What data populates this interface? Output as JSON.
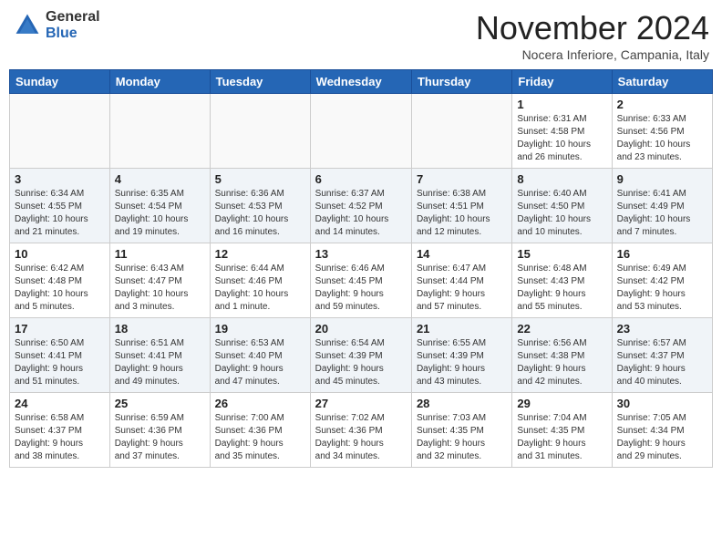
{
  "header": {
    "logo_general": "General",
    "logo_blue": "Blue",
    "month_title": "November 2024",
    "location": "Nocera Inferiore, Campania, Italy"
  },
  "days_of_week": [
    "Sunday",
    "Monday",
    "Tuesday",
    "Wednesday",
    "Thursday",
    "Friday",
    "Saturday"
  ],
  "weeks": [
    [
      {
        "day": "",
        "info": ""
      },
      {
        "day": "",
        "info": ""
      },
      {
        "day": "",
        "info": ""
      },
      {
        "day": "",
        "info": ""
      },
      {
        "day": "",
        "info": ""
      },
      {
        "day": "1",
        "info": "Sunrise: 6:31 AM\nSunset: 4:58 PM\nDaylight: 10 hours\nand 26 minutes."
      },
      {
        "day": "2",
        "info": "Sunrise: 6:33 AM\nSunset: 4:56 PM\nDaylight: 10 hours\nand 23 minutes."
      }
    ],
    [
      {
        "day": "3",
        "info": "Sunrise: 6:34 AM\nSunset: 4:55 PM\nDaylight: 10 hours\nand 21 minutes."
      },
      {
        "day": "4",
        "info": "Sunrise: 6:35 AM\nSunset: 4:54 PM\nDaylight: 10 hours\nand 19 minutes."
      },
      {
        "day": "5",
        "info": "Sunrise: 6:36 AM\nSunset: 4:53 PM\nDaylight: 10 hours\nand 16 minutes."
      },
      {
        "day": "6",
        "info": "Sunrise: 6:37 AM\nSunset: 4:52 PM\nDaylight: 10 hours\nand 14 minutes."
      },
      {
        "day": "7",
        "info": "Sunrise: 6:38 AM\nSunset: 4:51 PM\nDaylight: 10 hours\nand 12 minutes."
      },
      {
        "day": "8",
        "info": "Sunrise: 6:40 AM\nSunset: 4:50 PM\nDaylight: 10 hours\nand 10 minutes."
      },
      {
        "day": "9",
        "info": "Sunrise: 6:41 AM\nSunset: 4:49 PM\nDaylight: 10 hours\nand 7 minutes."
      }
    ],
    [
      {
        "day": "10",
        "info": "Sunrise: 6:42 AM\nSunset: 4:48 PM\nDaylight: 10 hours\nand 5 minutes."
      },
      {
        "day": "11",
        "info": "Sunrise: 6:43 AM\nSunset: 4:47 PM\nDaylight: 10 hours\nand 3 minutes."
      },
      {
        "day": "12",
        "info": "Sunrise: 6:44 AM\nSunset: 4:46 PM\nDaylight: 10 hours\nand 1 minute."
      },
      {
        "day": "13",
        "info": "Sunrise: 6:46 AM\nSunset: 4:45 PM\nDaylight: 9 hours\nand 59 minutes."
      },
      {
        "day": "14",
        "info": "Sunrise: 6:47 AM\nSunset: 4:44 PM\nDaylight: 9 hours\nand 57 minutes."
      },
      {
        "day": "15",
        "info": "Sunrise: 6:48 AM\nSunset: 4:43 PM\nDaylight: 9 hours\nand 55 minutes."
      },
      {
        "day": "16",
        "info": "Sunrise: 6:49 AM\nSunset: 4:42 PM\nDaylight: 9 hours\nand 53 minutes."
      }
    ],
    [
      {
        "day": "17",
        "info": "Sunrise: 6:50 AM\nSunset: 4:41 PM\nDaylight: 9 hours\nand 51 minutes."
      },
      {
        "day": "18",
        "info": "Sunrise: 6:51 AM\nSunset: 4:41 PM\nDaylight: 9 hours\nand 49 minutes."
      },
      {
        "day": "19",
        "info": "Sunrise: 6:53 AM\nSunset: 4:40 PM\nDaylight: 9 hours\nand 47 minutes."
      },
      {
        "day": "20",
        "info": "Sunrise: 6:54 AM\nSunset: 4:39 PM\nDaylight: 9 hours\nand 45 minutes."
      },
      {
        "day": "21",
        "info": "Sunrise: 6:55 AM\nSunset: 4:39 PM\nDaylight: 9 hours\nand 43 minutes."
      },
      {
        "day": "22",
        "info": "Sunrise: 6:56 AM\nSunset: 4:38 PM\nDaylight: 9 hours\nand 42 minutes."
      },
      {
        "day": "23",
        "info": "Sunrise: 6:57 AM\nSunset: 4:37 PM\nDaylight: 9 hours\nand 40 minutes."
      }
    ],
    [
      {
        "day": "24",
        "info": "Sunrise: 6:58 AM\nSunset: 4:37 PM\nDaylight: 9 hours\nand 38 minutes."
      },
      {
        "day": "25",
        "info": "Sunrise: 6:59 AM\nSunset: 4:36 PM\nDaylight: 9 hours\nand 37 minutes."
      },
      {
        "day": "26",
        "info": "Sunrise: 7:00 AM\nSunset: 4:36 PM\nDaylight: 9 hours\nand 35 minutes."
      },
      {
        "day": "27",
        "info": "Sunrise: 7:02 AM\nSunset: 4:36 PM\nDaylight: 9 hours\nand 34 minutes."
      },
      {
        "day": "28",
        "info": "Sunrise: 7:03 AM\nSunset: 4:35 PM\nDaylight: 9 hours\nand 32 minutes."
      },
      {
        "day": "29",
        "info": "Sunrise: 7:04 AM\nSunset: 4:35 PM\nDaylight: 9 hours\nand 31 minutes."
      },
      {
        "day": "30",
        "info": "Sunrise: 7:05 AM\nSunset: 4:34 PM\nDaylight: 9 hours\nand 29 minutes."
      }
    ]
  ]
}
